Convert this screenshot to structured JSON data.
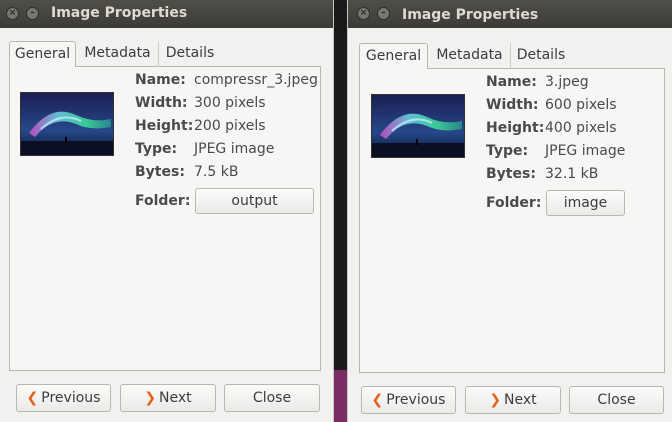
{
  "windows": [
    {
      "title": "Image Properties",
      "tabs": [
        "General",
        "Metadata",
        "Details"
      ],
      "fields": {
        "name_label": "Name:",
        "name": "compressr_3.jpeg",
        "width_label": "Width:",
        "width": "300 pixels",
        "height_label": "Height:",
        "height": "200 pixels",
        "type_label": "Type:",
        "type": "JPEG image",
        "bytes_label": "Bytes:",
        "bytes": "7.5 kB",
        "folder_label": "Folder:",
        "folder": "output"
      },
      "buttons": {
        "previous": "Previous",
        "next": "Next",
        "close": "Close"
      }
    },
    {
      "title": "Image Properties",
      "tabs": [
        "General",
        "Metadata",
        "Details"
      ],
      "fields": {
        "name_label": "Name:",
        "name": "3.jpeg",
        "width_label": "Width:",
        "width": "600 pixels",
        "height_label": "Height:",
        "height": "400 pixels",
        "type_label": "Type:",
        "type": "JPEG image",
        "bytes_label": "Bytes:",
        "bytes": "32.1 kB",
        "folder_label": "Folder:",
        "folder": "image"
      },
      "buttons": {
        "previous": "Previous",
        "next": "Next",
        "close": "Close"
      }
    }
  ],
  "icons": {
    "close": "close-icon",
    "minimize": "minimize-icon",
    "previous": "chevron-left-icon",
    "next": "chevron-right-icon"
  },
  "colors": {
    "accent": "#e2611c",
    "titlebar": "#3c3b37",
    "window_bg": "#f2f1f0"
  }
}
